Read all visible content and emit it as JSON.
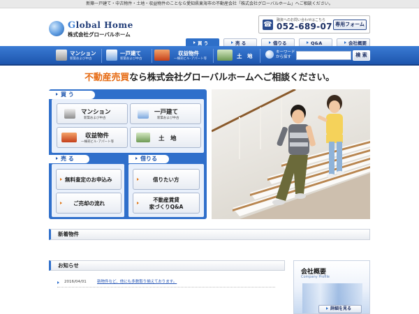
{
  "topbar": {
    "text": "新築一戸建て・中古物件・土地・収益物件のことなら愛知県東海市の不動産会社「株式会社グローバルホーム」へご相談ください。"
  },
  "logo": {
    "en_first": "G",
    "en_rest": "lobal Home",
    "ja": "株式会社グローバルホーム"
  },
  "contact": {
    "label": "融資へのお問い合わせはこちら",
    "phone": "052-689-0711",
    "form_button": "専用フォーム"
  },
  "tabs": [
    {
      "label": "買 う",
      "active": true
    },
    {
      "label": "売 る",
      "active": false
    },
    {
      "label": "借りる",
      "active": false
    },
    {
      "label": "Q&A",
      "active": false
    },
    {
      "label": "会社概要",
      "active": false
    }
  ],
  "nav": {
    "items": [
      {
        "title": "マンション",
        "sub": "新築および中古",
        "icon": "mansion-icon"
      },
      {
        "title": "一戸建て",
        "sub": "新築および中古",
        "icon": "house-icon"
      },
      {
        "title": "収益物件",
        "sub": "一棟売ビル･アパート等",
        "icon": "income-property-icon"
      },
      {
        "title": "土　地",
        "sub": "",
        "icon": "land-icon"
      }
    ],
    "keyword_line1": "キーワード",
    "keyword_line2": "から探す",
    "search_placeholder": "",
    "search_button": "検 索"
  },
  "headline": {
    "highlight": "不動産売買",
    "rest": "なら株式会社グローバルホームへご相談ください。"
  },
  "panel": {
    "buy_head": "買 う",
    "buy_items": [
      {
        "title": "マンション",
        "sub": "新築および中古"
      },
      {
        "title": "一戸建て",
        "sub": "新築および中古"
      },
      {
        "title": "収益物件",
        "sub": "一棟売ビル･アパート等"
      },
      {
        "title": "土　地",
        "sub": ""
      }
    ],
    "sell_head": "売 る",
    "sell_items": [
      "無料査定のお申込み",
      "ご売却の流れ"
    ],
    "rent_head": "借りる",
    "rent_items": [
      "借りたい方"
    ],
    "rent_item2_line1": "不動産賃貸",
    "rent_item2_line2": "家づくりQ&A"
  },
  "new_properties": {
    "title": "新着物件"
  },
  "news": {
    "title": "お知らせ",
    "items": [
      {
        "date": "2016/04/01",
        "text": "新物件など、他にも多数取り揃えております。"
      }
    ]
  },
  "company": {
    "title": "会社概要",
    "en": "Company Profile",
    "button": "詳細を見る"
  },
  "colors": {
    "brand_blue": "#2f6fcb",
    "accent_orange": "#e66a12"
  }
}
